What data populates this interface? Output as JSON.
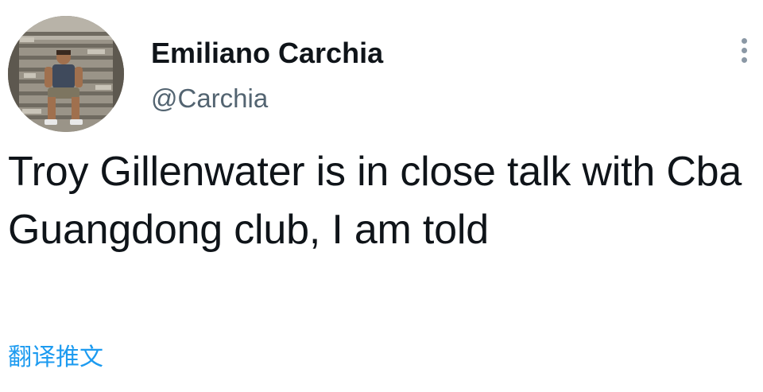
{
  "author": {
    "display_name": "Emiliano Carchia",
    "handle": "@Carchia",
    "avatar_icon": "profile-photo"
  },
  "more_icon": "more-vertical-icon",
  "tweet": {
    "text": "Troy Gillenwater is in close talk with Cba Guangdong club, I am told",
    "translate_label": "翻译推文"
  },
  "colors": {
    "text_primary": "#0f1419",
    "text_secondary": "#536471",
    "link": "#1d9bf0",
    "icon_muted": "#8b98a5"
  }
}
